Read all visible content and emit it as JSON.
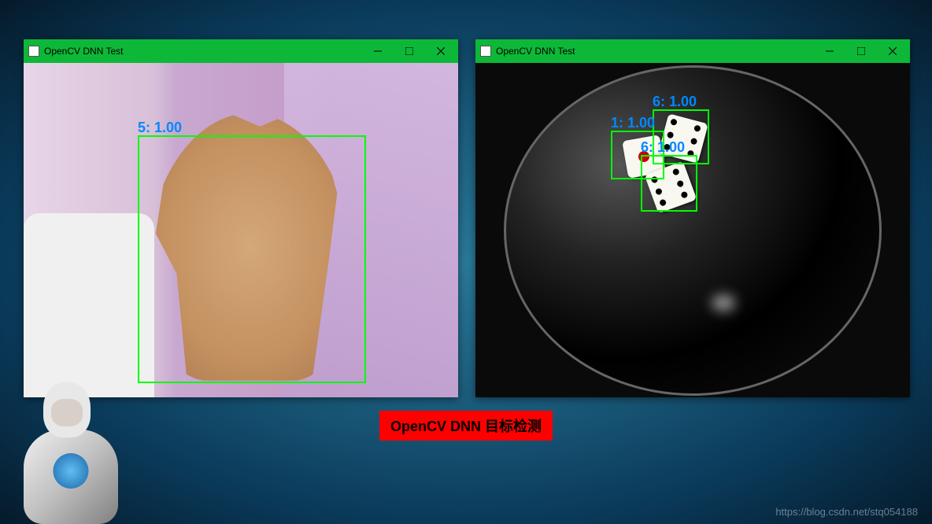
{
  "windows": {
    "left": {
      "title": "OpenCV DNN Test",
      "detections": [
        {
          "label": "5: 1.00"
        }
      ]
    },
    "right": {
      "title": "OpenCV DNN Test",
      "detections": [
        {
          "label": "6: 1.00"
        },
        {
          "label": "1: 1.00"
        },
        {
          "label": "6: 1.00"
        }
      ]
    }
  },
  "caption": "OpenCV DNN 目标检测",
  "watermark": "https://blog.csdn.net/stq054188"
}
